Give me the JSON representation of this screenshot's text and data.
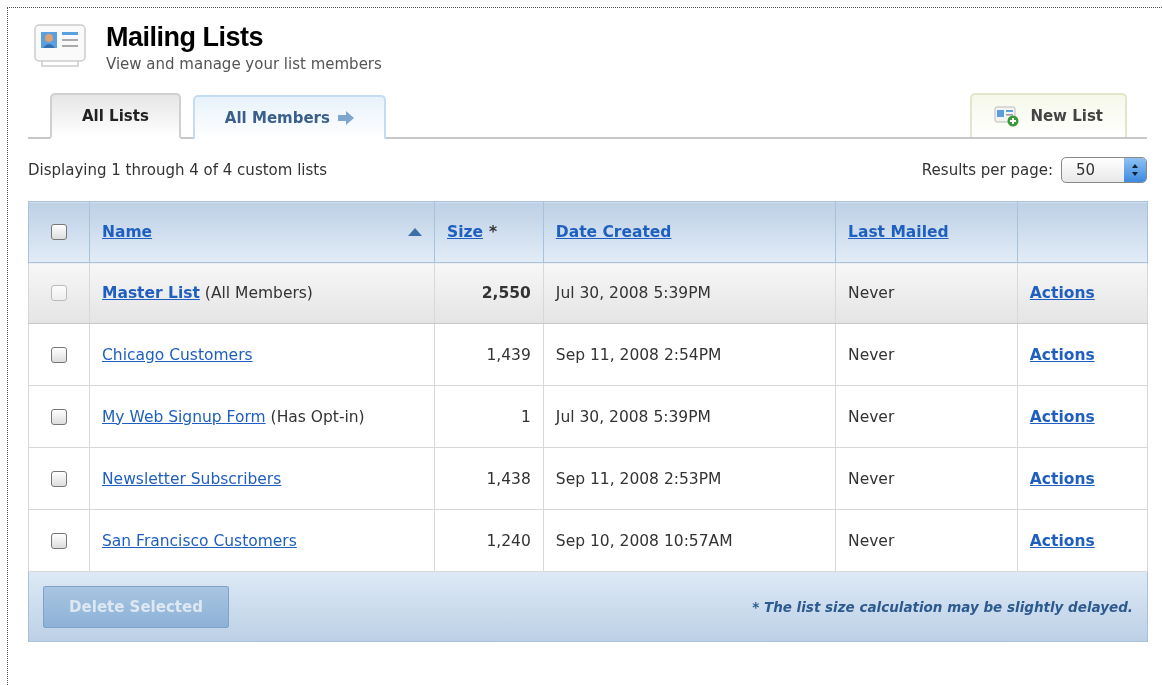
{
  "header": {
    "title": "Mailing Lists",
    "subtitle": "View and manage your list members"
  },
  "tabs": [
    {
      "label": "All Lists",
      "selected": true,
      "arrow": false
    },
    {
      "label": "All Members",
      "selected": false,
      "arrow": true
    }
  ],
  "new_list_button": "New List",
  "summary": "Displaying 1 through 4 of 4 custom lists",
  "results_per_page": {
    "label": "Results per page:",
    "value": "50"
  },
  "table": {
    "select_all_checked": false,
    "columns": [
      {
        "label": "Name",
        "sorted": true
      },
      {
        "label": "Size",
        "suffix": "*",
        "sorted": false
      },
      {
        "label": "Date Created",
        "sorted": false
      },
      {
        "label": "Last Mailed",
        "sorted": false
      }
    ],
    "rows": [
      {
        "kind": "master",
        "name": "Master List",
        "note": "(All Members)",
        "size": "2,550",
        "date_created": "Jul 30, 2008 5:39PM",
        "last_mailed": "Never",
        "action": "Actions",
        "checked": false,
        "disabled": true
      },
      {
        "kind": "custom",
        "name": "Chicago Customers",
        "size": "1,439",
        "date_created": "Sep 11, 2008 2:54PM",
        "last_mailed": "Never",
        "action": "Actions",
        "checked": false,
        "disabled": false
      },
      {
        "kind": "custom",
        "name": "My Web Signup Form",
        "note": "(Has Opt-in)",
        "size": "1",
        "date_created": "Jul 30, 2008 5:39PM",
        "last_mailed": "Never",
        "action": "Actions",
        "checked": false,
        "disabled": false
      },
      {
        "kind": "custom",
        "name": "Newsletter Subscribers",
        "size": "1,438",
        "date_created": "Sep 11, 2008 2:53PM",
        "last_mailed": "Never",
        "action": "Actions",
        "checked": false,
        "disabled": false
      },
      {
        "kind": "custom",
        "name": "San Francisco Customers",
        "size": "1,240",
        "date_created": "Sep 10, 2008 10:57AM",
        "last_mailed": "Never",
        "action": "Actions",
        "checked": false,
        "disabled": false
      }
    ]
  },
  "footer": {
    "delete_button": {
      "label": "Delete Selected",
      "disabled": true
    },
    "note": "* The list size calculation may be slightly delayed."
  }
}
